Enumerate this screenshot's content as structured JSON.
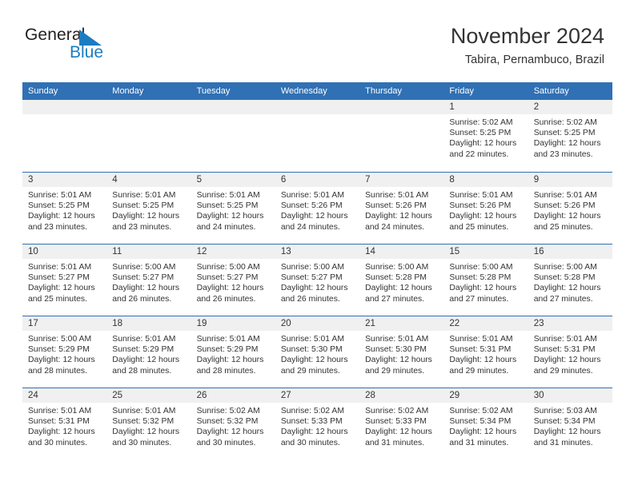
{
  "logo": {
    "text_primary": "General",
    "text_secondary": "Blue",
    "triangle_icon": "triangle-icon",
    "primary_color": "#231f20",
    "secondary_color": "#1b7cc2"
  },
  "header": {
    "title": "November 2024",
    "subtitle": "Tabira, Pernambuco, Brazil"
  },
  "theme": {
    "header_blue": "#3070b4",
    "day_band_gray": "#f0f0f0",
    "text_color": "#333333",
    "background": "#ffffff"
  },
  "weekdays": [
    "Sunday",
    "Monday",
    "Tuesday",
    "Wednesday",
    "Thursday",
    "Friday",
    "Saturday"
  ],
  "weeks": [
    [
      {
        "day": "",
        "sunrise": "",
        "sunset": "",
        "daylight_line1": "",
        "daylight_line2": "",
        "empty": true
      },
      {
        "day": "",
        "sunrise": "",
        "sunset": "",
        "daylight_line1": "",
        "daylight_line2": "",
        "empty": true
      },
      {
        "day": "",
        "sunrise": "",
        "sunset": "",
        "daylight_line1": "",
        "daylight_line2": "",
        "empty": true
      },
      {
        "day": "",
        "sunrise": "",
        "sunset": "",
        "daylight_line1": "",
        "daylight_line2": "",
        "empty": true
      },
      {
        "day": "",
        "sunrise": "",
        "sunset": "",
        "daylight_line1": "",
        "daylight_line2": "",
        "empty": true
      },
      {
        "day": "1",
        "sunrise": "Sunrise: 5:02 AM",
        "sunset": "Sunset: 5:25 PM",
        "daylight_line1": "Daylight: 12 hours",
        "daylight_line2": "and 22 minutes.",
        "empty": false
      },
      {
        "day": "2",
        "sunrise": "Sunrise: 5:02 AM",
        "sunset": "Sunset: 5:25 PM",
        "daylight_line1": "Daylight: 12 hours",
        "daylight_line2": "and 23 minutes.",
        "empty": false
      }
    ],
    [
      {
        "day": "3",
        "sunrise": "Sunrise: 5:01 AM",
        "sunset": "Sunset: 5:25 PM",
        "daylight_line1": "Daylight: 12 hours",
        "daylight_line2": "and 23 minutes.",
        "empty": false
      },
      {
        "day": "4",
        "sunrise": "Sunrise: 5:01 AM",
        "sunset": "Sunset: 5:25 PM",
        "daylight_line1": "Daylight: 12 hours",
        "daylight_line2": "and 23 minutes.",
        "empty": false
      },
      {
        "day": "5",
        "sunrise": "Sunrise: 5:01 AM",
        "sunset": "Sunset: 5:25 PM",
        "daylight_line1": "Daylight: 12 hours",
        "daylight_line2": "and 24 minutes.",
        "empty": false
      },
      {
        "day": "6",
        "sunrise": "Sunrise: 5:01 AM",
        "sunset": "Sunset: 5:26 PM",
        "daylight_line1": "Daylight: 12 hours",
        "daylight_line2": "and 24 minutes.",
        "empty": false
      },
      {
        "day": "7",
        "sunrise": "Sunrise: 5:01 AM",
        "sunset": "Sunset: 5:26 PM",
        "daylight_line1": "Daylight: 12 hours",
        "daylight_line2": "and 24 minutes.",
        "empty": false
      },
      {
        "day": "8",
        "sunrise": "Sunrise: 5:01 AM",
        "sunset": "Sunset: 5:26 PM",
        "daylight_line1": "Daylight: 12 hours",
        "daylight_line2": "and 25 minutes.",
        "empty": false
      },
      {
        "day": "9",
        "sunrise": "Sunrise: 5:01 AM",
        "sunset": "Sunset: 5:26 PM",
        "daylight_line1": "Daylight: 12 hours",
        "daylight_line2": "and 25 minutes.",
        "empty": false
      }
    ],
    [
      {
        "day": "10",
        "sunrise": "Sunrise: 5:01 AM",
        "sunset": "Sunset: 5:27 PM",
        "daylight_line1": "Daylight: 12 hours",
        "daylight_line2": "and 25 minutes.",
        "empty": false
      },
      {
        "day": "11",
        "sunrise": "Sunrise: 5:00 AM",
        "sunset": "Sunset: 5:27 PM",
        "daylight_line1": "Daylight: 12 hours",
        "daylight_line2": "and 26 minutes.",
        "empty": false
      },
      {
        "day": "12",
        "sunrise": "Sunrise: 5:00 AM",
        "sunset": "Sunset: 5:27 PM",
        "daylight_line1": "Daylight: 12 hours",
        "daylight_line2": "and 26 minutes.",
        "empty": false
      },
      {
        "day": "13",
        "sunrise": "Sunrise: 5:00 AM",
        "sunset": "Sunset: 5:27 PM",
        "daylight_line1": "Daylight: 12 hours",
        "daylight_line2": "and 26 minutes.",
        "empty": false
      },
      {
        "day": "14",
        "sunrise": "Sunrise: 5:00 AM",
        "sunset": "Sunset: 5:28 PM",
        "daylight_line1": "Daylight: 12 hours",
        "daylight_line2": "and 27 minutes.",
        "empty": false
      },
      {
        "day": "15",
        "sunrise": "Sunrise: 5:00 AM",
        "sunset": "Sunset: 5:28 PM",
        "daylight_line1": "Daylight: 12 hours",
        "daylight_line2": "and 27 minutes.",
        "empty": false
      },
      {
        "day": "16",
        "sunrise": "Sunrise: 5:00 AM",
        "sunset": "Sunset: 5:28 PM",
        "daylight_line1": "Daylight: 12 hours",
        "daylight_line2": "and 27 minutes.",
        "empty": false
      }
    ],
    [
      {
        "day": "17",
        "sunrise": "Sunrise: 5:00 AM",
        "sunset": "Sunset: 5:29 PM",
        "daylight_line1": "Daylight: 12 hours",
        "daylight_line2": "and 28 minutes.",
        "empty": false
      },
      {
        "day": "18",
        "sunrise": "Sunrise: 5:01 AM",
        "sunset": "Sunset: 5:29 PM",
        "daylight_line1": "Daylight: 12 hours",
        "daylight_line2": "and 28 minutes.",
        "empty": false
      },
      {
        "day": "19",
        "sunrise": "Sunrise: 5:01 AM",
        "sunset": "Sunset: 5:29 PM",
        "daylight_line1": "Daylight: 12 hours",
        "daylight_line2": "and 28 minutes.",
        "empty": false
      },
      {
        "day": "20",
        "sunrise": "Sunrise: 5:01 AM",
        "sunset": "Sunset: 5:30 PM",
        "daylight_line1": "Daylight: 12 hours",
        "daylight_line2": "and 29 minutes.",
        "empty": false
      },
      {
        "day": "21",
        "sunrise": "Sunrise: 5:01 AM",
        "sunset": "Sunset: 5:30 PM",
        "daylight_line1": "Daylight: 12 hours",
        "daylight_line2": "and 29 minutes.",
        "empty": false
      },
      {
        "day": "22",
        "sunrise": "Sunrise: 5:01 AM",
        "sunset": "Sunset: 5:31 PM",
        "daylight_line1": "Daylight: 12 hours",
        "daylight_line2": "and 29 minutes.",
        "empty": false
      },
      {
        "day": "23",
        "sunrise": "Sunrise: 5:01 AM",
        "sunset": "Sunset: 5:31 PM",
        "daylight_line1": "Daylight: 12 hours",
        "daylight_line2": "and 29 minutes.",
        "empty": false
      }
    ],
    [
      {
        "day": "24",
        "sunrise": "Sunrise: 5:01 AM",
        "sunset": "Sunset: 5:31 PM",
        "daylight_line1": "Daylight: 12 hours",
        "daylight_line2": "and 30 minutes.",
        "empty": false
      },
      {
        "day": "25",
        "sunrise": "Sunrise: 5:01 AM",
        "sunset": "Sunset: 5:32 PM",
        "daylight_line1": "Daylight: 12 hours",
        "daylight_line2": "and 30 minutes.",
        "empty": false
      },
      {
        "day": "26",
        "sunrise": "Sunrise: 5:02 AM",
        "sunset": "Sunset: 5:32 PM",
        "daylight_line1": "Daylight: 12 hours",
        "daylight_line2": "and 30 minutes.",
        "empty": false
      },
      {
        "day": "27",
        "sunrise": "Sunrise: 5:02 AM",
        "sunset": "Sunset: 5:33 PM",
        "daylight_line1": "Daylight: 12 hours",
        "daylight_line2": "and 30 minutes.",
        "empty": false
      },
      {
        "day": "28",
        "sunrise": "Sunrise: 5:02 AM",
        "sunset": "Sunset: 5:33 PM",
        "daylight_line1": "Daylight: 12 hours",
        "daylight_line2": "and 31 minutes.",
        "empty": false
      },
      {
        "day": "29",
        "sunrise": "Sunrise: 5:02 AM",
        "sunset": "Sunset: 5:34 PM",
        "daylight_line1": "Daylight: 12 hours",
        "daylight_line2": "and 31 minutes.",
        "empty": false
      },
      {
        "day": "30",
        "sunrise": "Sunrise: 5:03 AM",
        "sunset": "Sunset: 5:34 PM",
        "daylight_line1": "Daylight: 12 hours",
        "daylight_line2": "and 31 minutes.",
        "empty": false
      }
    ]
  ]
}
